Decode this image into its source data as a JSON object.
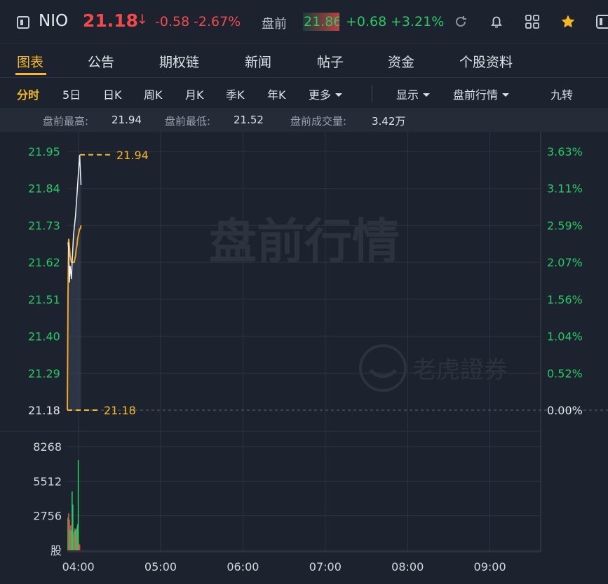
{
  "header": {
    "symbol": "NIO",
    "price": "21.18",
    "arrow": "↓",
    "change": "-0.58",
    "change_pct": "-2.67%",
    "premarket_label": "盘前",
    "premarket_price": "21.86",
    "premarket_change": "+0.68",
    "premarket_change_pct": "+3.21%",
    "icons": [
      "panel-toggle-icon",
      "refresh-icon",
      "bell-icon",
      "grid-icon",
      "star-icon",
      "panel-right-icon"
    ]
  },
  "tabs": [
    {
      "label": "图表",
      "active": true
    },
    {
      "label": "公告"
    },
    {
      "label": "期权链"
    },
    {
      "label": "新闻"
    },
    {
      "label": "帖子"
    },
    {
      "label": "资金"
    },
    {
      "label": "个股资料"
    }
  ],
  "periods": {
    "items": [
      "分时",
      "5日",
      "日K",
      "周K",
      "月K",
      "季K",
      "年K",
      "更多"
    ],
    "active": "分时",
    "display": "显示",
    "session": "盘前行情",
    "nine": "九转"
  },
  "stats": {
    "high_label": "盘前最高:",
    "high": "21.94",
    "low_label": "盘前最低:",
    "low": "21.52",
    "volume_label": "盘前成交量:",
    "volume": "3.42万"
  },
  "chart_data": {
    "type": "line",
    "watermark": "盘前行情",
    "brand_watermark": "老虎證券",
    "base_price": 21.18,
    "price_ylim": [
      21.18,
      21.95
    ],
    "price_ticks": [
      "21.95",
      "21.84",
      "21.73",
      "21.62",
      "21.51",
      "21.40",
      "21.29",
      "21.18"
    ],
    "pct_ticks": [
      "3.63%",
      "3.11%",
      "2.59%",
      "2.07%",
      "1.56%",
      "1.04%",
      "0.52%",
      "0.00%"
    ],
    "high_marker": "21.94",
    "base_marker": "21.18",
    "x_ticks": [
      "04:00",
      "05:00",
      "06:00",
      "07:00",
      "08:00",
      "09:00"
    ],
    "x_range_minutes": [
      0,
      345
    ],
    "series": [
      {
        "minutes": [
          0.5,
          1,
          1.5,
          2,
          2.5,
          3,
          3.5,
          4,
          4.5,
          5,
          5.5,
          6,
          6.5,
          7,
          7.5,
          8,
          8.5,
          9,
          9.5,
          10
        ],
        "values": [
          21.68,
          21.66,
          21.56,
          21.61,
          21.59,
          21.57,
          21.62,
          21.66,
          21.7,
          21.72,
          21.74,
          21.76,
          21.79,
          21.82,
          21.85,
          21.88,
          21.91,
          21.94,
          21.89,
          21.85
        ]
      },
      {
        "minutes": [
          0,
          0.5,
          1,
          1.5,
          2,
          2.5,
          3,
          3.5,
          4,
          4.5,
          5,
          5.5,
          6,
          6.5,
          7,
          7.5,
          8,
          8.5,
          9,
          9.5,
          10
        ],
        "values": [
          21.18,
          21.52,
          21.69,
          21.67,
          21.64,
          21.63,
          21.62,
          21.62,
          21.62,
          21.62,
          21.62,
          21.63,
          21.64,
          21.66,
          21.67,
          21.69,
          21.7,
          21.71,
          21.72,
          21.72,
          21.73
        ]
      }
    ],
    "volume": {
      "ticks": [
        "8268",
        "5512",
        "2756",
        "股"
      ],
      "ylim": [
        0,
        9500
      ],
      "bars": [
        {
          "minute": 0.5,
          "value": 3000,
          "color": "green"
        },
        {
          "minute": 1,
          "value": 3400,
          "color": "red"
        },
        {
          "minute": 1.5,
          "value": 2800,
          "color": "red"
        },
        {
          "minute": 2,
          "value": 1900,
          "color": "green"
        },
        {
          "minute": 2.5,
          "value": 2300,
          "color": "red"
        },
        {
          "minute": 3,
          "value": 1800,
          "color": "green"
        },
        {
          "minute": 3.5,
          "value": 5400,
          "color": "green"
        },
        {
          "minute": 4,
          "value": 4200,
          "color": "green"
        },
        {
          "minute": 4.5,
          "value": 1400,
          "color": "red"
        },
        {
          "minute": 5,
          "value": 1700,
          "color": "green"
        },
        {
          "minute": 5.5,
          "value": 2000,
          "color": "red"
        },
        {
          "minute": 6,
          "value": 1900,
          "color": "green"
        },
        {
          "minute": 6.5,
          "value": 1800,
          "color": "red"
        },
        {
          "minute": 7,
          "value": 2100,
          "color": "green"
        },
        {
          "minute": 7.5,
          "value": 2400,
          "color": "green"
        },
        {
          "minute": 8,
          "value": 8268,
          "color": "green"
        },
        {
          "minute": 8.5,
          "value": 600,
          "color": "red"
        },
        {
          "minute": 9,
          "value": 500,
          "color": "red"
        }
      ]
    },
    "colors": {
      "up": "#27c964",
      "down": "#f04a4a",
      "price_line": "#f0f2f5",
      "avg_line": "#f5a623",
      "marker": "#f5b926"
    }
  }
}
